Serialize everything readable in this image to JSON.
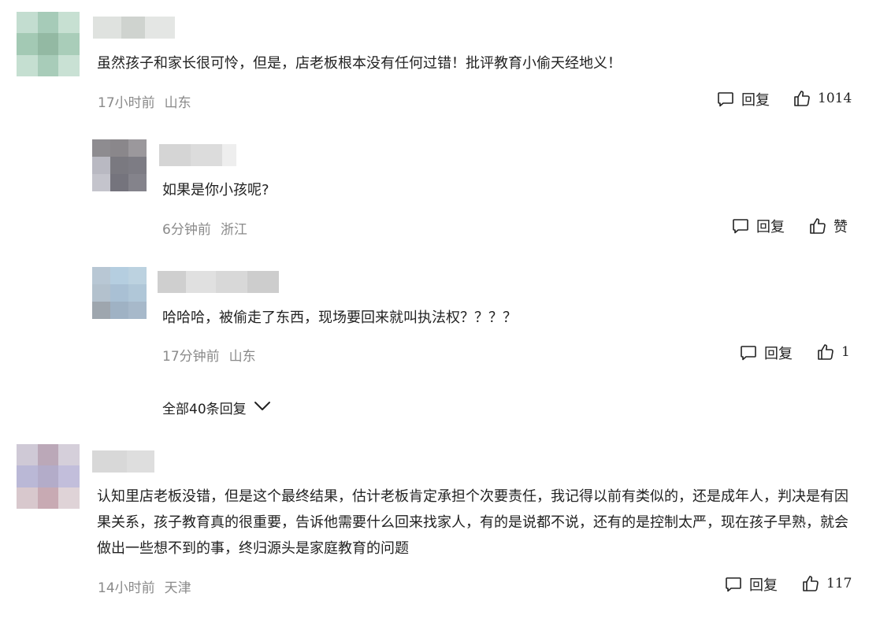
{
  "comments": [
    {
      "text": "虽然孩子和家长很可怜，但是，店老板根本没有任何过错！批评教育小偷天经地义！",
      "time": "17小时前",
      "location": "山东",
      "reply_label": "回复",
      "like_label": "1014"
    },
    {
      "text": "如果是你小孩呢?",
      "time": "6分钟前",
      "location": "浙江",
      "reply_label": "回复",
      "like_label": "赞"
    },
    {
      "text": "哈哈哈，被偷走了东西，现场要回来就叫执法权？？？？",
      "time": "17分钟前",
      "location": "山东",
      "reply_label": "回复",
      "like_label": "1"
    },
    {
      "text": "认知里店老板没错，但是这个最终结果，估计老板肯定承担个次要责任，我记得以前有类似的，还是成年人，判决是有因果关系，孩子教育真的很重要，告诉他需要什么回来找家人，有的是说都不说，还有的是控制太严，现在孩子早熟，就会做出一些想不到的事，终归源头是家庭教育的问题",
      "time": "14小时前",
      "location": "天津",
      "reply_label": "回复",
      "like_label": "117"
    }
  ],
  "more_replies_label": "全部40条回复",
  "icons": {
    "reply": "comment-bubble-icon",
    "like": "thumbs-up-icon",
    "expand": "chevron-down-icon"
  },
  "colors": {
    "text": "#222222",
    "meta": "#8a8a8a"
  }
}
